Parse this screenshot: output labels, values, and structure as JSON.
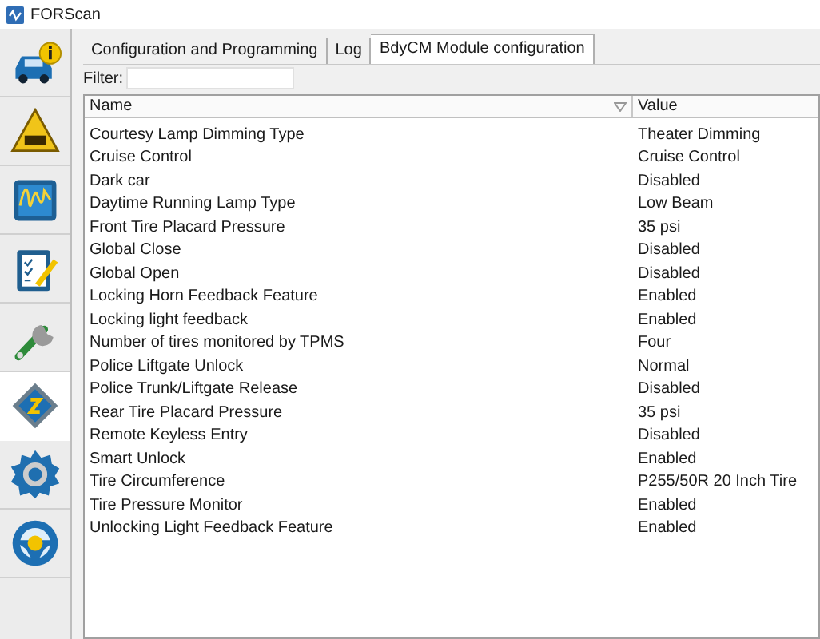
{
  "window": {
    "title": "FORScan"
  },
  "sidebar": {
    "items": [
      {
        "kind": "info",
        "selected": false
      },
      {
        "kind": "dtc",
        "selected": false
      },
      {
        "kind": "oscilloscope",
        "selected": false
      },
      {
        "kind": "checklist",
        "selected": false
      },
      {
        "kind": "wrench",
        "selected": false
      },
      {
        "kind": "chip",
        "selected": true
      },
      {
        "kind": "gear",
        "selected": false
      },
      {
        "kind": "help",
        "selected": false
      }
    ]
  },
  "tabs": [
    {
      "label": "Configuration and Programming",
      "selected": false
    },
    {
      "label": "Log",
      "selected": false
    },
    {
      "label": "BdyCM Module configuration",
      "selected": true
    }
  ],
  "filter": {
    "label": "Filter:"
  },
  "table": {
    "columns": [
      "Name",
      "Value"
    ],
    "rows": [
      [
        "Courtesy Lamp Dimming Type",
        "Theater Dimming"
      ],
      [
        "Cruise Control",
        "Cruise Control"
      ],
      [
        "Dark car",
        "Disabled"
      ],
      [
        "Daytime Running Lamp Type",
        "Low Beam"
      ],
      [
        "Front Tire Placard Pressure",
        "35 psi"
      ],
      [
        "Global Close",
        "Disabled"
      ],
      [
        "Global Open",
        "Disabled"
      ],
      [
        "Locking Horn Feedback Feature",
        "Enabled"
      ],
      [
        "Locking light feedback",
        "Enabled"
      ],
      [
        "Number of tires monitored by TPMS",
        "Four"
      ],
      [
        "Police Liftgate Unlock",
        "Normal"
      ],
      [
        "Police Trunk/Liftgate Release",
        "Disabled"
      ],
      [
        "Rear Tire Placard Pressure",
        "35 psi"
      ],
      [
        "Remote Keyless Entry",
        "Disabled"
      ],
      [
        "Smart Unlock",
        "Enabled"
      ],
      [
        "Tire Circumference",
        "P255/50R 20 Inch Tire"
      ],
      [
        "Tire Pressure Monitor",
        "Enabled"
      ],
      [
        "Unlocking Light Feedback Feature",
        "Enabled"
      ]
    ]
  }
}
